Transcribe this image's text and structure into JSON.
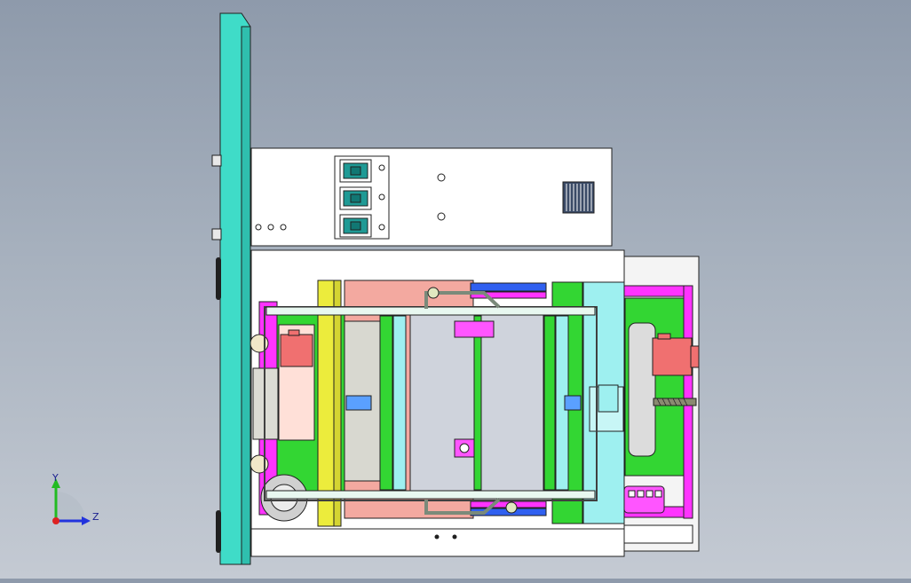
{
  "viewport": {
    "background_top": "#8e9aab",
    "background_bottom": "#c4cad3"
  },
  "model": {
    "colors": {
      "panel": "#3fdcc8",
      "cabinet": "#ffffff",
      "outline": "#202020",
      "frame_green": "#33d633",
      "frame_magenta": "#ff33ff",
      "slab_pink": "#f3a9a0",
      "motor": "#f07070",
      "rail_yellow": "#ecec3c",
      "blue_bar": "#3060f0",
      "cyan_block": "#9ef0f0",
      "switch_teal": "#1f9a95",
      "screw": "#8a8a70"
    },
    "icons": {
      "switch": "rocker-switch-icon",
      "vent": "vent-grille-icon",
      "motor": "servo-motor-icon"
    }
  },
  "triad": {
    "y_label": "Y",
    "z_label": "Z",
    "y_color": "#22bb22",
    "z_color": "#2233dd",
    "origin_color": "#dd2222"
  }
}
